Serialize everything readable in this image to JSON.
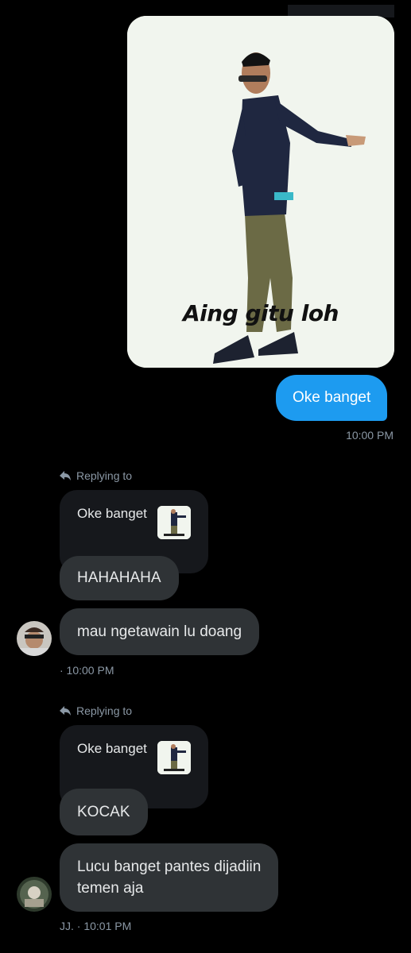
{
  "outgoing": {
    "meme_caption": "Aing gitu loh",
    "message": "Oke banget",
    "timestamp": "10:00 PM"
  },
  "threads": [
    {
      "replying_label": "Replying to",
      "quote_text": "Oke banget",
      "messages": [
        "HAHAHAHA",
        "mau ngetawain lu doang"
      ],
      "meta": "· 10:00 PM"
    },
    {
      "replying_label": "Replying to",
      "quote_text": "Oke banget",
      "messages": [
        "KOCAK",
        "Lucu banget pantes dijadiin",
        "temen aja"
      ],
      "meta": "JJ. · 10:01 PM"
    }
  ],
  "colors": {
    "background": "#000000",
    "outgoing_bubble": "#1d9bf0",
    "incoming_bubble": "#2f3336",
    "quote_card": "#16181c",
    "muted_text": "#8b98a5"
  },
  "icons": [
    "reply-arrow-icon",
    "avatar"
  ]
}
